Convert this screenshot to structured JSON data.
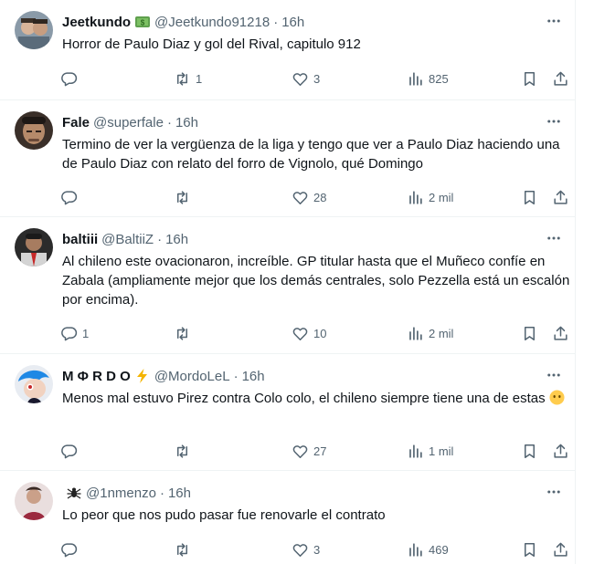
{
  "tweets": [
    {
      "name": "Jeetkundo",
      "badge_icon": "money-emoji",
      "handle": "@Jeetkundo91218",
      "time": "16h",
      "text": "Horror de Paulo Diaz y gol del Rival, capitulo 912",
      "replies": "",
      "retweets": "1",
      "likes": "3",
      "views": "825"
    },
    {
      "name": "Fale",
      "handle": "@superfale",
      "time": "16h",
      "text": "Termino de ver la vergüenza de la liga y tengo que ver a Paulo Diaz haciendo una de Paulo Diaz con relato del forro de Vignolo, qué Domingo",
      "replies": "",
      "retweets": "",
      "likes": "28",
      "views": "2 mil"
    },
    {
      "name": "baltiii",
      "handle": "@BaltiiZ",
      "time": "16h",
      "text": "Al chileno este ovacionaron, increíble. GP titular hasta que el Muñeco confíe en Zabala (ampliamente mejor que los demás centrales, solo Pezzella está un escalón por encima).",
      "replies": "1",
      "retweets": "",
      "likes": "10",
      "views": "2 mil"
    },
    {
      "name": "M Φ R D O",
      "badge_icon": "lightning-emoji",
      "handle": "@MordoLeL",
      "time": "16h",
      "text": "Menos mal estuvo Pirez contra Colo colo, el chileno siempre tiene una de estas",
      "text_emoji": "no-mouth-face-emoji",
      "replies": "",
      "retweets": "",
      "likes": "27",
      "views": "1 mil"
    },
    {
      "name": "",
      "badge_icon": "spider-emoji",
      "handle": "@1nmenzo",
      "time": "16h",
      "text": "Lo peor que nos pudo pasar fue renovarle el contrato",
      "replies": "",
      "retweets": "",
      "likes": "3",
      "views": "469"
    }
  ],
  "separator": "·",
  "colors": {
    "text": "#0f1419",
    "secondary": "#536471",
    "divider": "#eff3f4",
    "background": "#ffffff"
  },
  "icons": [
    "reply-icon",
    "retweet-icon",
    "like-icon",
    "views-icon",
    "bookmark-icon",
    "share-icon",
    "more-icon"
  ]
}
